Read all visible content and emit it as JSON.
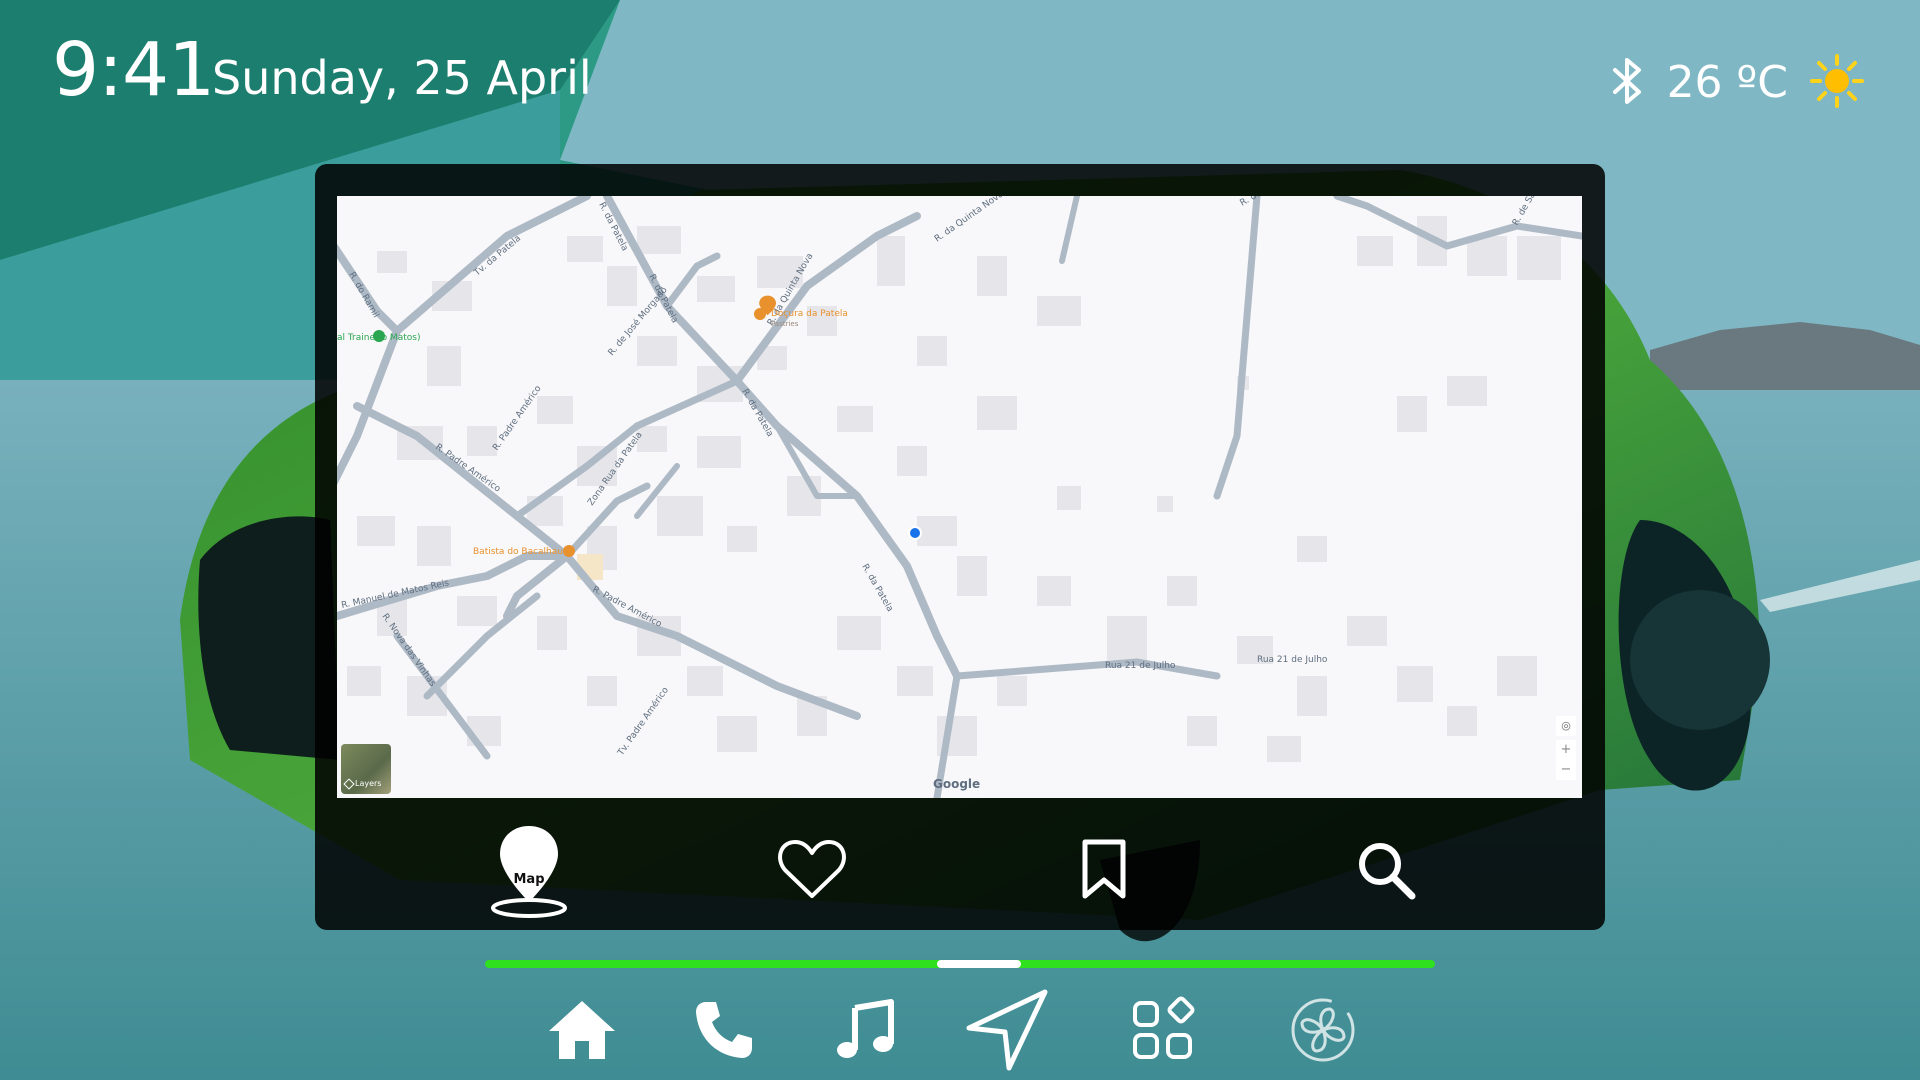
{
  "status_bar": {
    "time": "9:41",
    "date": "Sunday, 25 April",
    "temperature": "26 ºC",
    "bluetooth_icon": "bluetooth-icon",
    "weather_icon": "sun-icon"
  },
  "map": {
    "streets": [
      "R. do Ramil",
      "Tv. da Patela",
      "R. da Patela",
      "R. da Quinta Nova",
      "R. da Quinta Nova",
      "R. de São Brás",
      "R. de São Brás",
      "R. da Patela",
      "R. de José Morgado",
      "R. Padre Américo",
      "R. da Patela",
      "Zona Rua da Patela",
      "R. Padre Américo",
      "R. Padre Américo",
      "R. Manuel de Matos Reis",
      "R. Nova das Vinhas",
      "Tv. Padre Américo",
      "Rua 21 de Julho",
      "Rua 21 de Julho",
      "R. da Patela"
    ],
    "pois": [
      {
        "name": "Doçura da Patela",
        "category": "Pastries",
        "color": "#e8912d"
      },
      {
        "name": "Batista do Bacalhau",
        "category": "",
        "color": "#e8912d"
      },
      {
        "name": "al Trainer\no Matos)",
        "category": "",
        "color": "#2aa651"
      }
    ],
    "layers_label": "Layers",
    "attribution": "Google",
    "zoom_in": "+",
    "zoom_out": "−"
  },
  "toolbar": {
    "map_label": "Map",
    "items": [
      "map-pin-icon",
      "heart-icon",
      "bookmark-icon",
      "search-icon"
    ]
  },
  "progress": {
    "fraction": 0.52
  },
  "dock": {
    "items": [
      "home-icon",
      "phone-icon",
      "music-icon",
      "navigation-icon",
      "apps-icon",
      "fan-icon"
    ]
  },
  "colors": {
    "accent_green": "#2ee01e",
    "panel_bg": "#000000",
    "map_bg": "#f8f7f9",
    "road": "#aeb9c6"
  }
}
